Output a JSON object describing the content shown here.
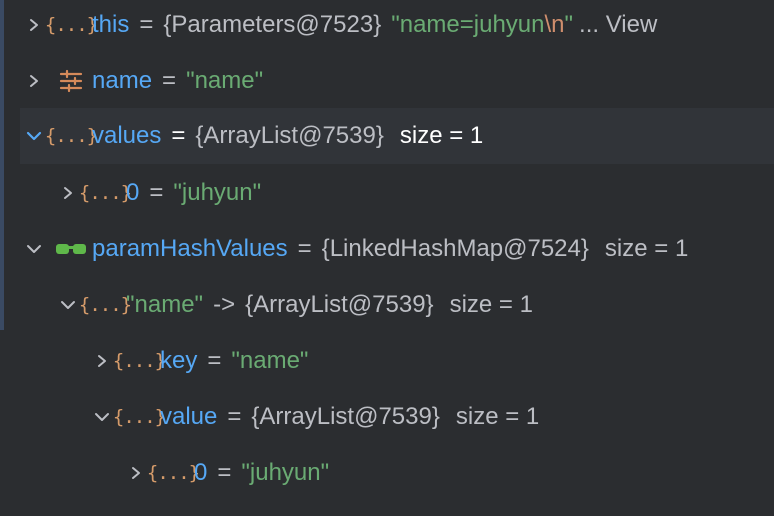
{
  "tree": {
    "rows": [
      {
        "name": "this",
        "type_ref": "{Parameters@7523}",
        "value_prefix": "\"name=juhyun",
        "value_escape": "\\n",
        "value_suffix": "\"",
        "trail": "... View"
      },
      {
        "name": "name",
        "value": "\"name\""
      },
      {
        "name": "values",
        "type_ref": "{ArrayList@7539}",
        "size": "size = 1"
      },
      {
        "name": "0",
        "value": "\"juhyun\""
      },
      {
        "name": "paramHashValues",
        "type_ref": "{LinkedHashMap@7524}",
        "size": "size = 1"
      },
      {
        "key": "\"name\"",
        "arrow": "->",
        "type_ref": "{ArrayList@7539}",
        "size": "size = 1"
      },
      {
        "name": "key",
        "value": "\"name\""
      },
      {
        "name": "value",
        "type_ref": "{ArrayList@7539}",
        "size": "size = 1"
      },
      {
        "name": "0",
        "value": "\"juhyun\""
      }
    ],
    "equals": "=",
    "object_icon_text": "{...}"
  },
  "colors": {
    "background": "#2b2d30",
    "selected_row": "#313439",
    "variable_name": "#56a8f5",
    "string_value": "#6aab73",
    "object_icon": "#d59b6a",
    "plain_text": "#bcbec4"
  },
  "icons": {
    "collapsed": "chevron-right-icon",
    "expanded": "chevron-down-icon",
    "object": "object-icon",
    "field": "field-settings-icon",
    "watch": "watch-glasses-icon"
  }
}
